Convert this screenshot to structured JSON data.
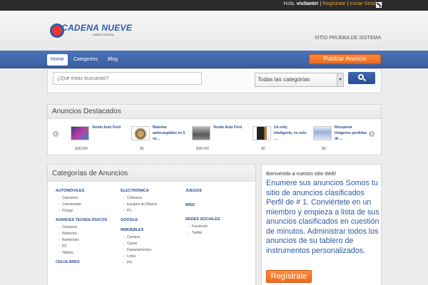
{
  "topbar": {
    "greeting": "Hola,",
    "visitor": "visitante!",
    "sep1": "|",
    "register": "Regístrate",
    "sep2": "|",
    "login": "Iniciar Sesión",
    "sep3": "|"
  },
  "header": {
    "logo_text": "CADENA NUEVE",
    "logo_sub": "DIARIO DIGITAL",
    "slogan": "SITIO PRUEBA DE SISTEMA"
  },
  "nav": {
    "items": [
      "Home",
      "Categories",
      "Blog"
    ],
    "publish": "Publicar Anuncio"
  },
  "search": {
    "placeholder": "¿Qué estás buscando?",
    "category_selected": "Todas las categorías"
  },
  "featured": {
    "title": "Anuncios Destacados",
    "items": [
      {
        "title": "Vendo Auto Ford",
        "price": "$38,000"
      },
      {
        "title": "Baterías autocargables en 5 se...",
        "price": "$0"
      },
      {
        "title": "Vendo Auto Ford",
        "price": "$38,000"
      },
      {
        "title": "Un reloj inteligente, no solo ...",
        "price": "$0"
      },
      {
        "title": "Recuperar imágenes perdidas de ...",
        "price": "$0"
      }
    ]
  },
  "categories": {
    "title": "Categorías de Anuncios",
    "col1": [
      {
        "name": "AUTOMÓVILES",
        "subs": [
          "Camiones",
          "Camionetas",
          "Pickup"
        ]
      },
      {
        "name": "AVANCES TECNOLÓGICOS",
        "subs": [
          "Celulares",
          "Netbooks",
          "Notebooks",
          "PC",
          "Tablets"
        ]
      },
      {
        "name": "CELULARES",
        "subs": []
      }
    ],
    "col2": [
      {
        "name": "ELECTRÓNICA",
        "subs": [
          "Celulares",
          "Equipos de Música",
          "PC"
        ]
      },
      {
        "name": "GOOGLE",
        "subs": []
      },
      {
        "name": "INMUEBLES",
        "subs": [
          "Campos",
          "Casas",
          "Departamentos",
          "Lotes",
          "PH"
        ]
      }
    ],
    "col3": [
      {
        "name": "JUEGOS",
        "subs": []
      },
      {
        "name": "MISC",
        "subs": []
      },
      {
        "name": "REDES SOCIALES",
        "subs": [
          "Facebook",
          "Twitter"
        ]
      }
    ]
  },
  "welcome": {
    "title": "Bienvenido a nuestro sitio Web!",
    "text": "Enumere sus anuncios Somos tu sitio de anuncios clasificados Perfil de # 1. Conviértete en un miembro y empieza a lista de sus anuncios clasificados en cuestión de minutos. Administrar todos los anuncios de su tablero de instrumentos personalizados.",
    "register": "Regístrate"
  },
  "colors": {
    "nav_blue": "#3a5fa0",
    "accent_orange": "#f06a18",
    "link_blue": "#2a4d8f"
  }
}
